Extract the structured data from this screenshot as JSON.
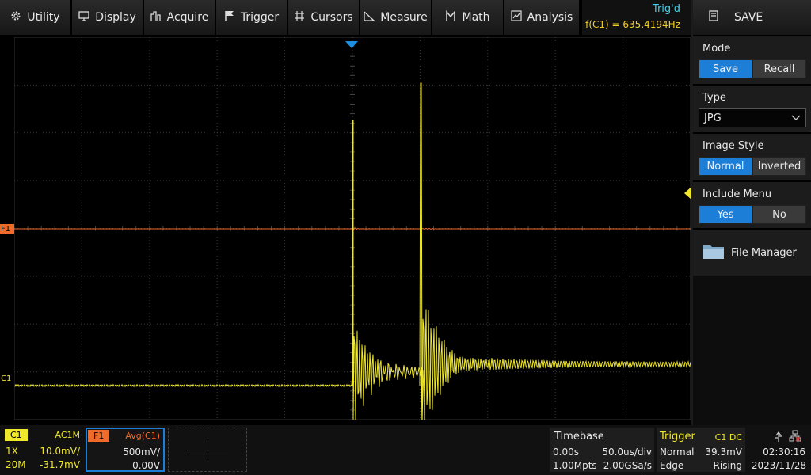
{
  "menu": {
    "utility": "Utility",
    "display": "Display",
    "acquire": "Acquire",
    "trigger": "Trigger",
    "cursors": "Cursors",
    "measure": "Measure",
    "math": "Math",
    "analysis": "Analysis"
  },
  "trigger_status": "Trig'd",
  "freq_readout": "f(C1) = 635.4194Hz",
  "panel": {
    "title": "SAVE",
    "mode": {
      "label": "Mode",
      "options": [
        "Save",
        "Recall"
      ],
      "selected": "Save"
    },
    "type": {
      "label": "Type",
      "value": "JPG"
    },
    "image_style": {
      "label": "Image Style",
      "options": [
        "Normal",
        "Inverted"
      ],
      "selected": "Normal"
    },
    "include_menu": {
      "label": "Include Menu",
      "options": [
        "Yes",
        "No"
      ],
      "selected": "Yes"
    },
    "file_manager": "File Manager"
  },
  "markers": {
    "f1": "F1",
    "c1": "C1"
  },
  "channels": {
    "c1": {
      "name": "C1",
      "coupling": "AC1M",
      "probe": "1X",
      "scale": "10.0mV/",
      "bw": "20M",
      "offset": "-31.7mV"
    },
    "f1": {
      "name": "F1",
      "source": "Avg(C1)",
      "scale": "500mV/",
      "offset": "0.00V"
    }
  },
  "timebase": {
    "label": "Timebase",
    "delay": "0.00s",
    "scale": "50.0us/div",
    "memory": "1.00Mpts",
    "sample_rate": "2.00GSa/s"
  },
  "trigger_info": {
    "label": "Trigger",
    "source": "C1 DC",
    "mode": "Normal",
    "level": "39.3mV",
    "type": "Edge",
    "slope": "Rising"
  },
  "clock": {
    "time": "02:30:16",
    "date": "2023/11/28"
  },
  "colors": {
    "c1": "#f0e82a",
    "f1": "#f06a2a",
    "accent": "#1c7ed6",
    "trig": "#3fd0ea"
  }
}
